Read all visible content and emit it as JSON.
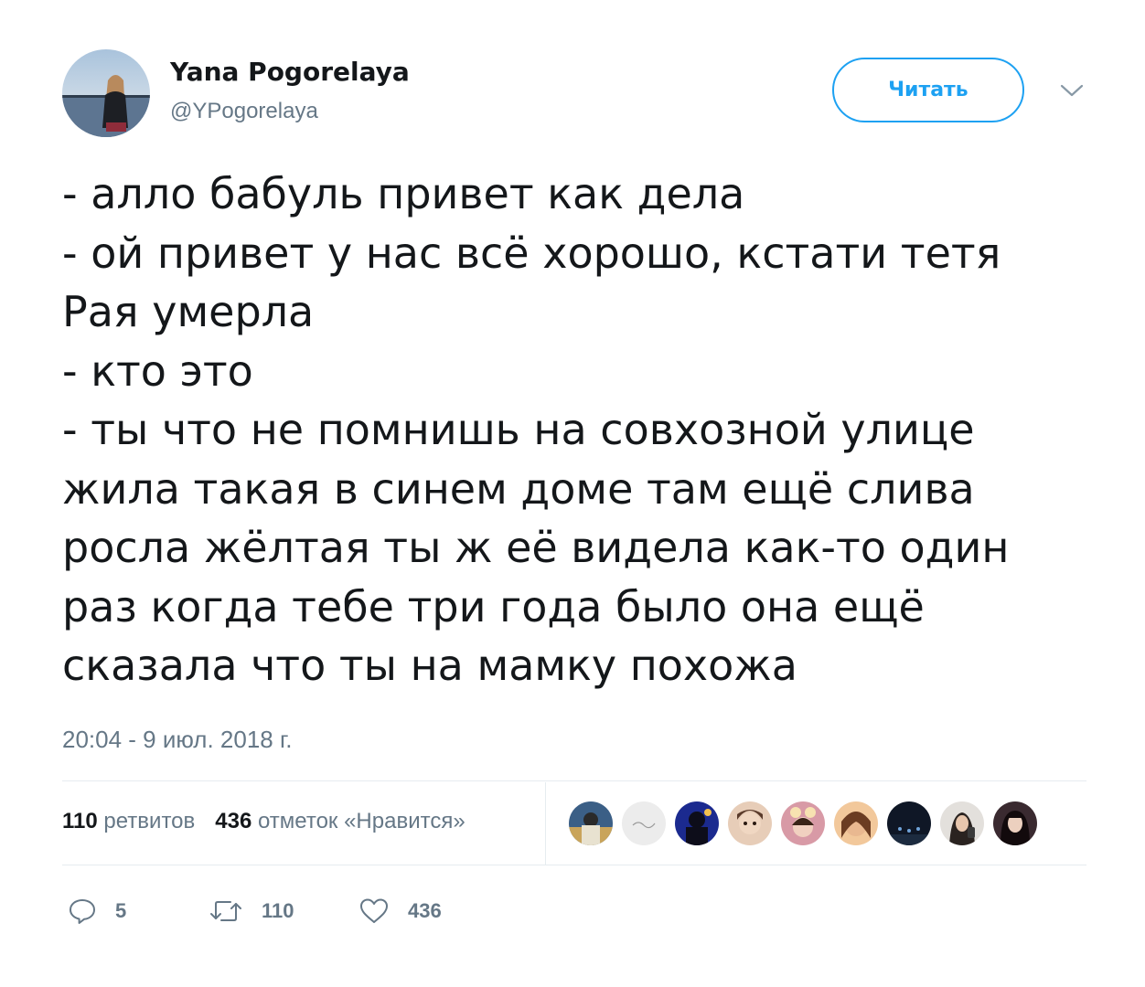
{
  "tweet": {
    "author": {
      "display_name": "Yana Pogorelaya",
      "handle": "@YPogorelaya"
    },
    "follow_label": "Читать",
    "lines": [
      "- алло бабуль привет как дела",
      "- ой привет у нас всё хорошо, кстати тетя",
      "Рая умерла",
      "- кто это",
      "- ты что не помнишь на совхозной улице",
      "жила такая в синем доме там ещё слива",
      "росла жёлтая ты ж её видела как-то один",
      "раз когда тебе три года было она ещё",
      "сказала что ты на мамку похожа"
    ],
    "timestamp": "20:04 - 9 июл. 2018 г.",
    "stats": {
      "retweets_count": "110",
      "retweets_label": "ретвитов",
      "likes_count": "436",
      "likes_label": "отметок «Нравится»"
    },
    "actions": {
      "replies": "5",
      "retweets": "110",
      "likes": "436"
    }
  },
  "colors": {
    "accent": "#1da1f2",
    "text": "#14171a",
    "muted": "#657786",
    "divider": "#e6ecf0"
  },
  "icons": {
    "reply": "reply-icon",
    "retweet": "retweet-icon",
    "like": "heart-icon",
    "menu": "chevron-down-icon"
  }
}
